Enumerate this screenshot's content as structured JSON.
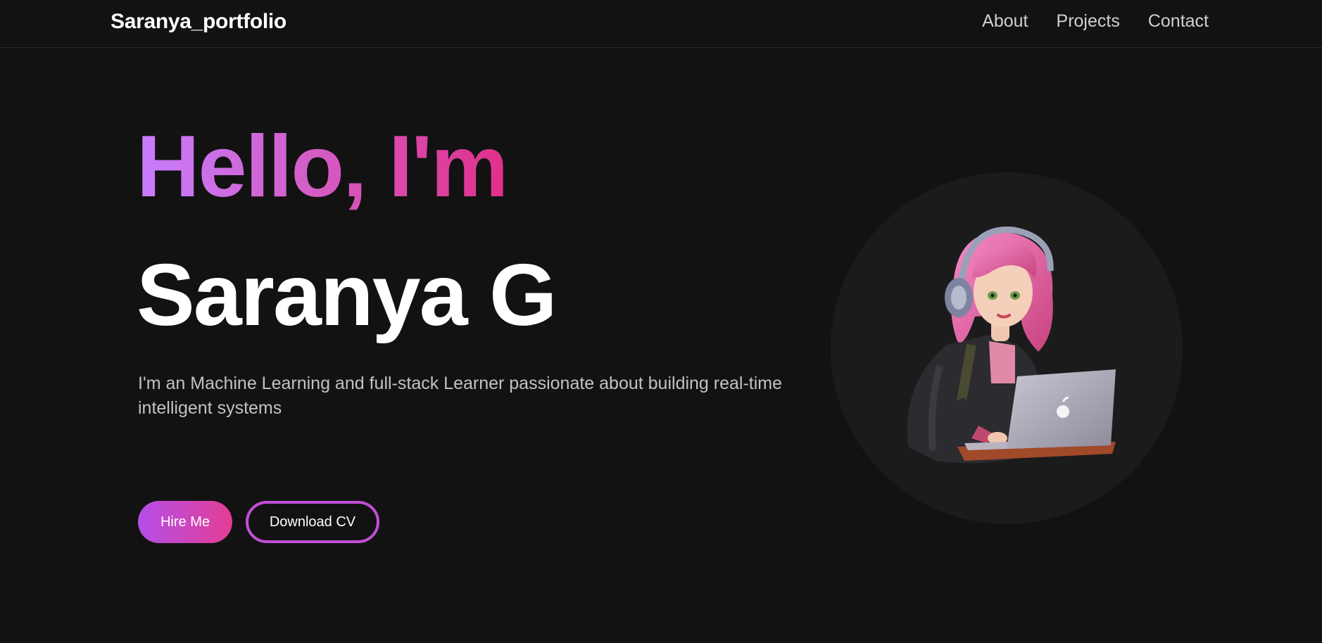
{
  "navbar": {
    "brand": "Saranya_portfolio",
    "links": [
      {
        "label": "About"
      },
      {
        "label": "Projects"
      },
      {
        "label": "Contact"
      }
    ]
  },
  "hero": {
    "greeting": "Hello, I'm",
    "name": "Saranya G",
    "tagline": "I'm an Machine Learning and full-stack Learner passionate about building real-time intelligent systems",
    "hire_button": "Hire Me",
    "cv_button": "Download CV"
  },
  "avatar": {
    "icon": "avatar-illustration-girl-laptop-icon"
  },
  "colors": {
    "background": "#121212",
    "gradient_start": "#c77dff",
    "gradient_end": "#e0308a",
    "button_gradient_start": "#b44ee8",
    "button_gradient_end": "#e33e95",
    "outline_button_border": "#c24ed6"
  }
}
